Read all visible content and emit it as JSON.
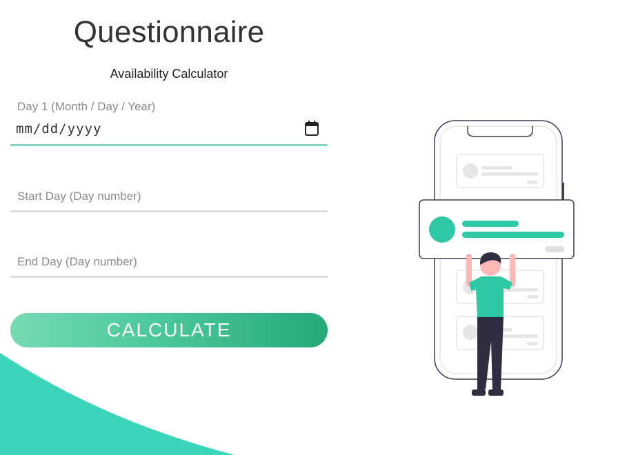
{
  "header": {
    "title": "Questionnaire",
    "subtitle": "Availability Calculator"
  },
  "form": {
    "day1": {
      "label": "Day 1 (Month / Day / Year)",
      "placeholder": "mm/dd/yyyy",
      "icon": "calendar-icon"
    },
    "start_day": {
      "label": "Start Day (Day number)"
    },
    "end_day": {
      "label": "End Day (Day number)"
    },
    "calculate_label": "CALCULATE"
  },
  "colors": {
    "accent": "#2ec9a4",
    "wave": "#3bd6b9",
    "button_gradient_start": "#76dbb2",
    "button_gradient_end": "#26a978",
    "field_underline": "#dcdcdc",
    "active_underline": "#7fd9bd"
  },
  "illustration": {
    "name": "person-holding-card-phone-illustration"
  }
}
